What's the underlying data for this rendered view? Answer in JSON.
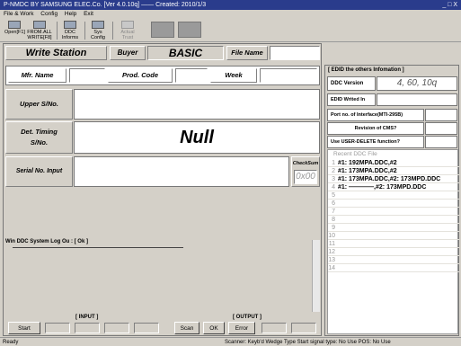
{
  "window": {
    "title": "P-NMDC BY SAMSUNG ELEC.Co. [Ver 4.0.10q] —— Created: 2010/1/3",
    "controls": "_ □ X"
  },
  "menu": [
    "File & Work",
    "Config",
    "Help",
    "Exit"
  ],
  "toolbar": {
    "buttons": [
      {
        "label": "Open[F1]",
        "icon": "open-file-icon"
      },
      {
        "label": "FROM.ALL WRITE[F8]",
        "icon": "write-icon"
      },
      {
        "label": "DDC Informs",
        "icon": "info-icon"
      },
      {
        "label": "Sys Config",
        "icon": "config-icon"
      },
      {
        "label": "Actual Trust",
        "icon": "trust-icon"
      }
    ]
  },
  "header": {
    "station": "Write Station",
    "buyer_label": "Buyer",
    "buyer_value": "BASIC",
    "file_label": "File Name",
    "file_value": ""
  },
  "form": {
    "mfr_label": "Mfr. Name",
    "mfr_value": "",
    "prod_label": "Prod. Code",
    "prod_value": "",
    "week_label": "Week",
    "week_value": "",
    "upper_label": "Upper S/No.",
    "upper_value": "",
    "det_timing_label": "Det. Timing",
    "det_timing_label2": "S/No.",
    "det_timing_value": "Null",
    "serial_label": "Serial No. Input",
    "serial_value": "",
    "checksum_label": "CheckSum",
    "checksum_value": "0x00"
  },
  "log": {
    "title": "Win DDC System Log Ou : [ Ok ]"
  },
  "bottom": {
    "input_label": "[ INPUT ]",
    "output_label": "[ OUTPUT ]",
    "start": "Start",
    "scan": "Scan",
    "ok": "OK",
    "error": "Error"
  },
  "edid": {
    "title": "[ EDID the others Infomation ]",
    "ddc_version_label": "DDC Version",
    "ddc_version_value": "4, 60, 10q",
    "edid_written_label": "EDID Writed In",
    "edid_written_value": "",
    "port_label": "Port no. of Interface(MTI-295B)",
    "port_value": "",
    "revision_label": "Revision of CMS?",
    "revision_value": "",
    "user_delete_label": "Use USER-DELETE function?",
    "user_delete_value": ""
  },
  "recent": {
    "title": "Recent DDC File",
    "rows": [
      {
        "num": "1",
        "text": "#1: 192MPA.DDC,#2"
      },
      {
        "num": "2",
        "text": "#1: 173MPA.DDC,#2"
      },
      {
        "num": "3",
        "text": "#1: 173MPA.DDC,#2: 173MPD.DDC"
      },
      {
        "num": "4",
        "text": "#1: ————,#2: 173MPD.DDC"
      },
      {
        "num": "5",
        "text": ""
      },
      {
        "num": "6",
        "text": ""
      },
      {
        "num": "7",
        "text": ""
      },
      {
        "num": "8",
        "text": ""
      },
      {
        "num": "9",
        "text": ""
      },
      {
        "num": "10",
        "text": ""
      },
      {
        "num": "11",
        "text": ""
      },
      {
        "num": "12",
        "text": ""
      },
      {
        "num": "13",
        "text": ""
      },
      {
        "num": "14",
        "text": ""
      }
    ]
  },
  "statusbar": {
    "left": "Ready",
    "right": "Scanner: Keyb'd Wedge Type  Start signal type: No Use   POS: No Use"
  }
}
